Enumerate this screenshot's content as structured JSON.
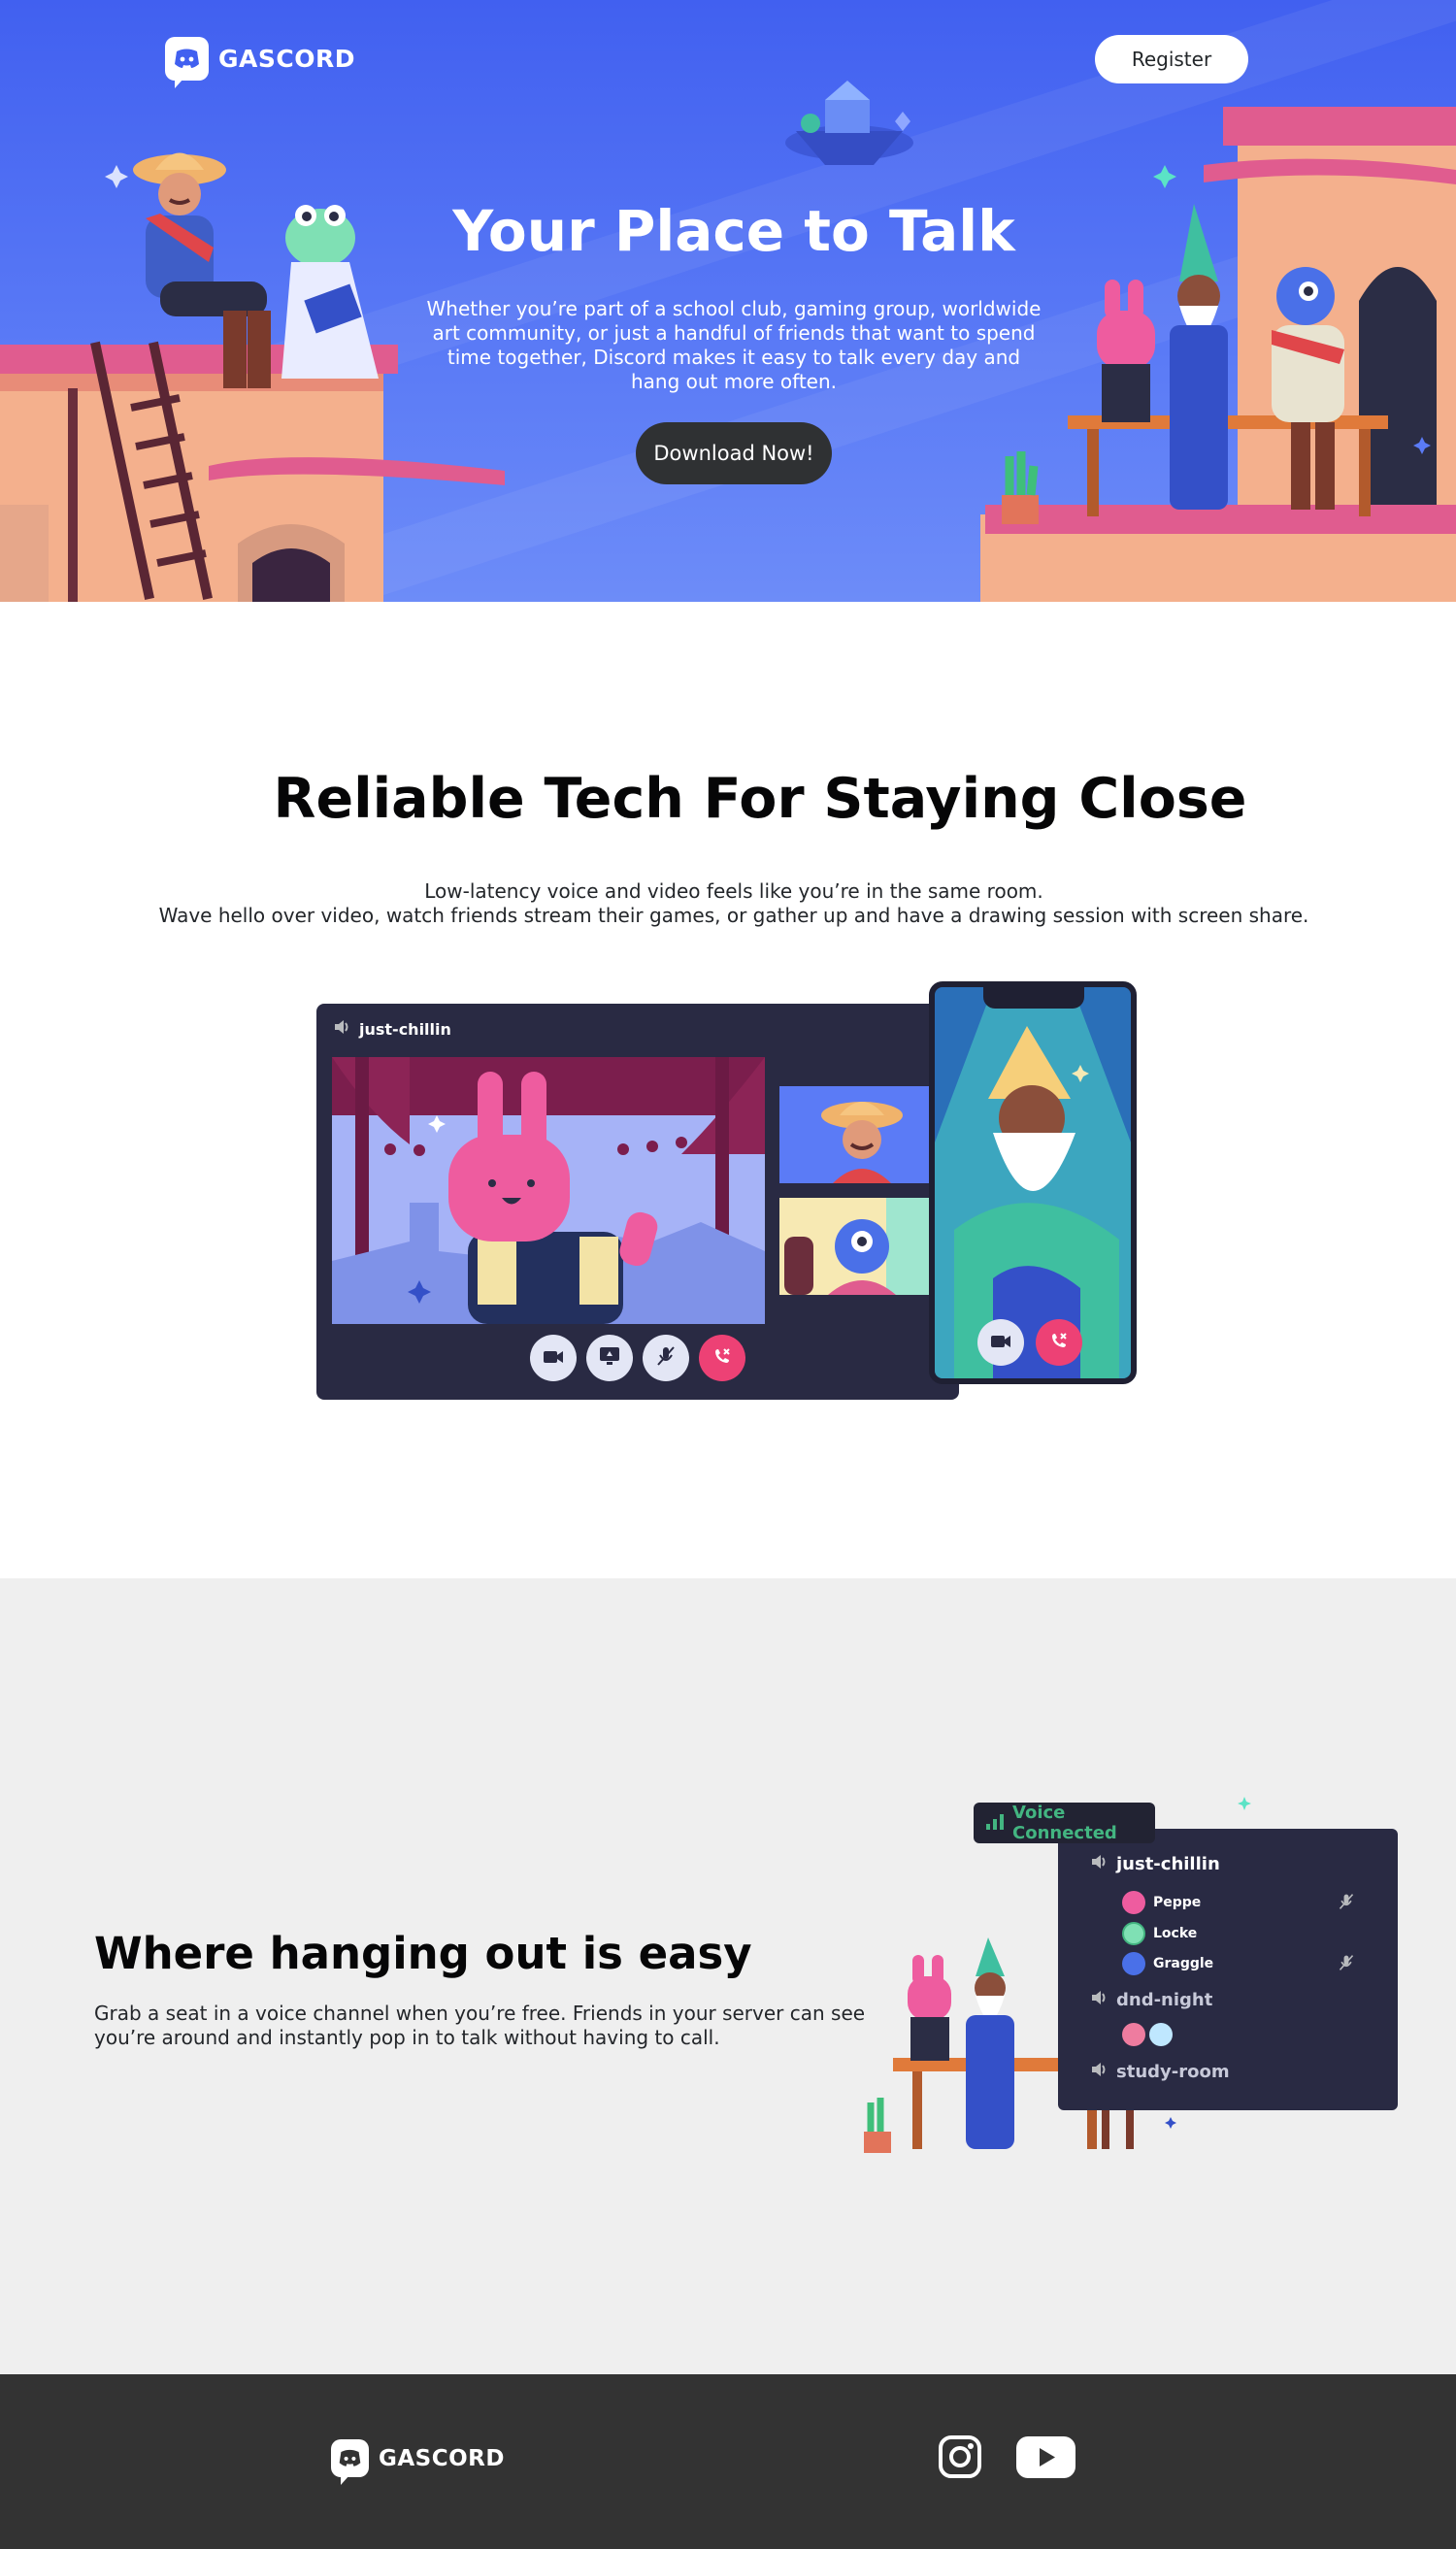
{
  "brand": {
    "name": "GASCORD"
  },
  "header": {
    "register_label": "Register"
  },
  "hero": {
    "title": "Your Place to Talk",
    "subtitle": "Whether you’re part of a school club, gaming group, worldwide art community, or just a handful of friends that want to spend time together, Discord makes it easy to talk every day and hang out more often.",
    "download_label": "Download Now!"
  },
  "tech": {
    "title": "Reliable Tech For Staying Close",
    "desc_line1": "Low-latency voice and video feels like you’re in the same room.",
    "desc_line2": "Wave hello over video, watch friends stream their games, or gather up and have a drawing session with screen share.",
    "call_channel": "just-chillin"
  },
  "hangout": {
    "title": "Where hanging out is easy",
    "desc": "Grab a seat in a voice channel when you’re free. Friends in your server can see you’re around and instantly pop in to talk without having to call.",
    "voice_connected": "Voice Connected",
    "channels": [
      {
        "name": "just-chillin",
        "members": [
          {
            "name": "Peppe",
            "muted": true
          },
          {
            "name": "Locke",
            "muted": false
          },
          {
            "name": "Graggle",
            "muted": true
          }
        ]
      },
      {
        "name": "dnd-night"
      },
      {
        "name": "study-room"
      }
    ]
  },
  "footer": {
    "social": [
      "instagram-icon",
      "youtube-icon"
    ]
  },
  "colors": {
    "blurple": "#4160f0",
    "dark": "#292a43",
    "green": "#43b581",
    "red": "#ed4175",
    "footer": "#333333"
  }
}
